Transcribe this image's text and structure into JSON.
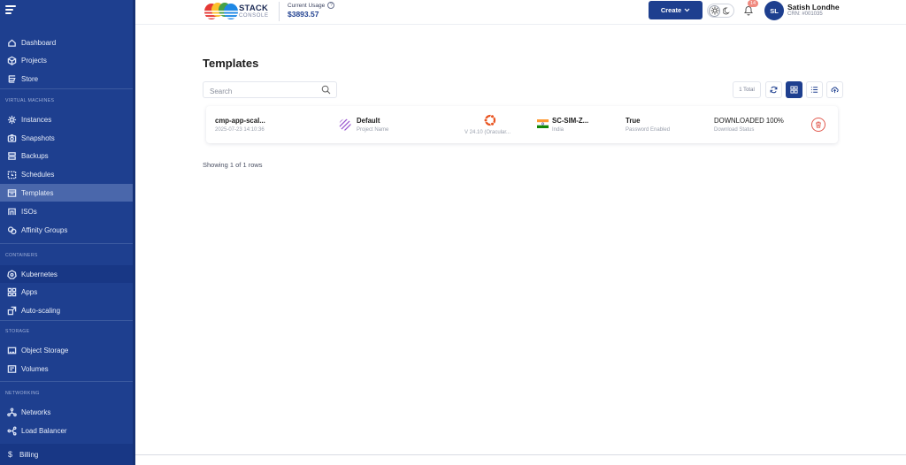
{
  "header": {
    "logo_line1": "STACK",
    "logo_line2": "CONSOLE",
    "usage_label": "Current Usage",
    "usage_help": "?",
    "usage_value": "$3893.57",
    "create_label": "Create",
    "notification_count": "14",
    "user_initials": "SL",
    "user_name": "Satish Londhe",
    "user_crn": "CRN: #001035"
  },
  "sidebar": {
    "top_items": [
      {
        "label": "Dashboard",
        "icon": "home-icon"
      },
      {
        "label": "Projects",
        "icon": "cube-icon"
      },
      {
        "label": "Store",
        "icon": "store-icon"
      }
    ],
    "sections": [
      {
        "title": "VIRTUAL MACHINES",
        "items": [
          {
            "label": "Instances",
            "icon": "instances-icon"
          },
          {
            "label": "Snapshots",
            "icon": "snapshot-icon"
          },
          {
            "label": "Backups",
            "icon": "backup-icon"
          },
          {
            "label": "Schedules",
            "icon": "schedule-icon"
          },
          {
            "label": "Templates",
            "icon": "template-icon",
            "active": true
          },
          {
            "label": "ISOs",
            "icon": "iso-icon"
          },
          {
            "label": "Affinity Groups",
            "icon": "affinity-icon"
          }
        ]
      },
      {
        "title": "CONTAINERS",
        "items": [
          {
            "label": "Kubernetes",
            "icon": "kubernetes-icon"
          },
          {
            "label": "Apps",
            "icon": "apps-icon"
          },
          {
            "label": "Auto-scaling",
            "icon": "autoscaling-icon"
          }
        ]
      },
      {
        "title": "STORAGE",
        "items": [
          {
            "label": "Object Storage",
            "icon": "object-storage-icon"
          },
          {
            "label": "Volumes",
            "icon": "volume-icon"
          }
        ]
      },
      {
        "title": "NETWORKING",
        "items": [
          {
            "label": "Networks",
            "icon": "network-icon"
          },
          {
            "label": "Load Balancer",
            "icon": "load-balancer-icon"
          }
        ]
      }
    ],
    "billing_label": "Billing",
    "billing_icon": "$"
  },
  "main": {
    "title": "Templates",
    "search_placeholder": "Search",
    "total_label": "1 Total",
    "rows": [
      {
        "name": "cmp-app-scal...",
        "created": "2025-07-23 14:10:36",
        "project": "Default",
        "project_label": "Project Name",
        "os_version": "V 24.10 (Oracular...",
        "zone": "SC-SIM-Z...",
        "country": "India",
        "password_enabled": "True",
        "password_label": "Password Enabled",
        "status": "DOWNLOADED 100%",
        "status_label": "Download Status"
      }
    ],
    "showing": "Showing 1 of 1 rows"
  },
  "colors": {
    "sidebar_bg": "#1e3f8f",
    "accent": "#1e3f8f",
    "danger": "#e15a4f"
  }
}
